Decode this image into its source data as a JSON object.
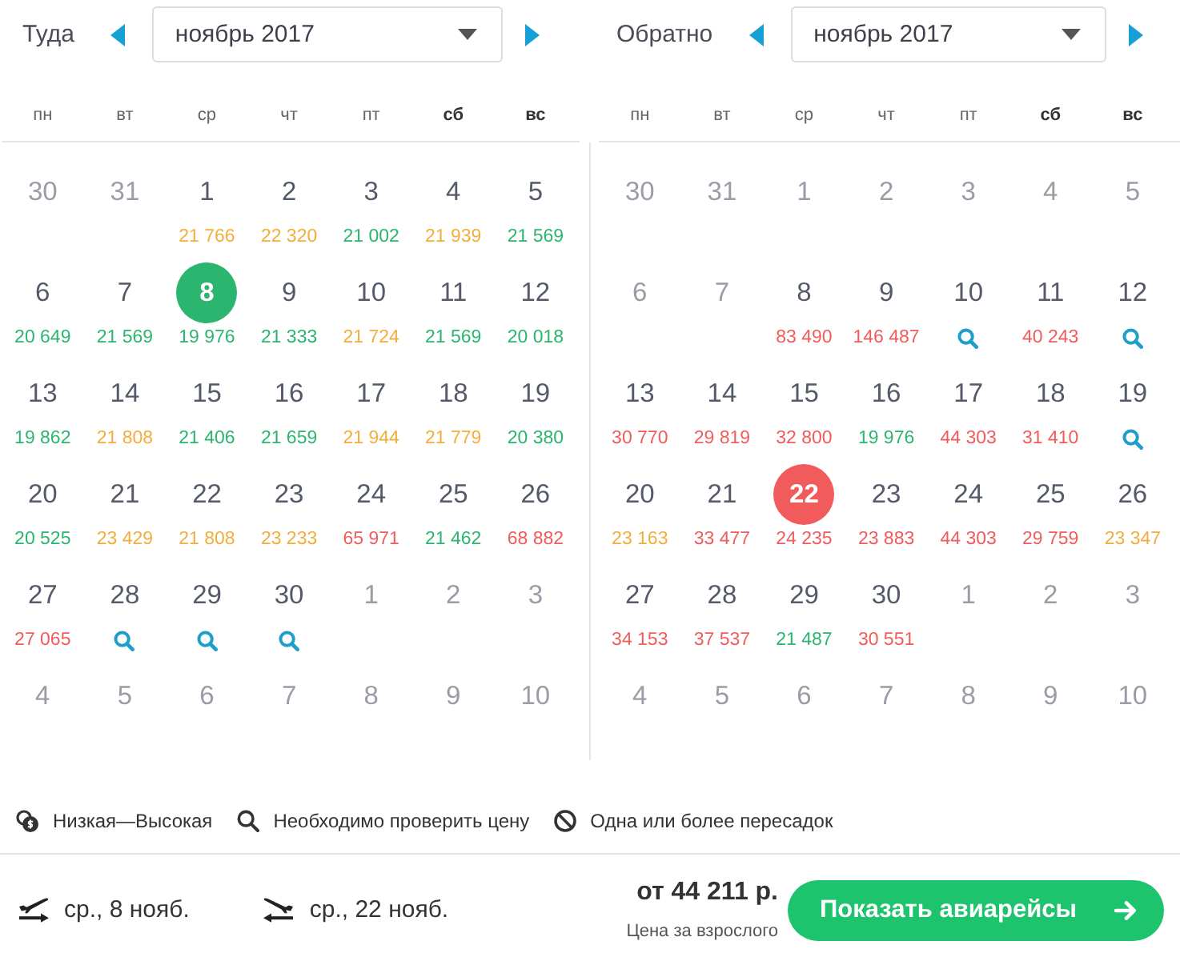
{
  "calendars": [
    {
      "label": "Туда",
      "month": "ноябрь 2017",
      "weekdays": [
        {
          "label": "пн",
          "weekend": false
        },
        {
          "label": "вт",
          "weekend": false
        },
        {
          "label": "ср",
          "weekend": false
        },
        {
          "label": "чт",
          "weekend": false
        },
        {
          "label": "пт",
          "weekend": false
        },
        {
          "label": "сб",
          "weekend": true
        },
        {
          "label": "вс",
          "weekend": true
        }
      ],
      "weeks": [
        [
          {
            "day": "30",
            "kind": "inactive",
            "selected": false
          },
          {
            "day": "31",
            "kind": "inactive",
            "selected": false
          },
          {
            "day": "1",
            "kind": "price",
            "price": "21 766",
            "color": "#f4ad3c",
            "selected": false
          },
          {
            "day": "2",
            "kind": "price",
            "price": "22 320",
            "color": "#f4ad3c",
            "selected": false
          },
          {
            "day": "3",
            "kind": "price",
            "price": "21 002",
            "color": "#2bb56f",
            "selected": false
          },
          {
            "day": "4",
            "kind": "price",
            "price": "21 939",
            "color": "#f4ad3c",
            "selected": false
          },
          {
            "day": "5",
            "kind": "price",
            "price": "21 569",
            "color": "#2bb56f",
            "selected": false
          }
        ],
        [
          {
            "day": "6",
            "kind": "price",
            "price": "20 649",
            "color": "#2bb56f",
            "selected": false
          },
          {
            "day": "7",
            "kind": "price",
            "price": "21 569",
            "color": "#2bb56f",
            "selected": false
          },
          {
            "day": "8",
            "kind": "price",
            "price": "19 976",
            "color": "#2bb56f",
            "selected": true
          },
          {
            "day": "9",
            "kind": "price",
            "price": "21 333",
            "color": "#2bb56f",
            "selected": false
          },
          {
            "day": "10",
            "kind": "price",
            "price": "21 724",
            "color": "#f4ad3c",
            "selected": false
          },
          {
            "day": "11",
            "kind": "price",
            "price": "21 569",
            "color": "#2bb56f",
            "selected": false
          },
          {
            "day": "12",
            "kind": "price",
            "price": "20 018",
            "color": "#2bb56f",
            "selected": false
          }
        ],
        [
          {
            "day": "13",
            "kind": "price",
            "price": "19 862",
            "color": "#2bb56f",
            "selected": false
          },
          {
            "day": "14",
            "kind": "price",
            "price": "21 808",
            "color": "#f4ad3c",
            "selected": false
          },
          {
            "day": "15",
            "kind": "price",
            "price": "21 406",
            "color": "#2bb56f",
            "selected": false
          },
          {
            "day": "16",
            "kind": "price",
            "price": "21 659",
            "color": "#2bb56f",
            "selected": false
          },
          {
            "day": "17",
            "kind": "price",
            "price": "21 944",
            "color": "#f4ad3c",
            "selected": false
          },
          {
            "day": "18",
            "kind": "price",
            "price": "21 779",
            "color": "#f4ad3c",
            "selected": false
          },
          {
            "day": "19",
            "kind": "price",
            "price": "20 380",
            "color": "#2bb56f",
            "selected": false
          }
        ],
        [
          {
            "day": "20",
            "kind": "price",
            "price": "20 525",
            "color": "#2bb56f",
            "selected": false
          },
          {
            "day": "21",
            "kind": "price",
            "price": "23 429",
            "color": "#f4ad3c",
            "selected": false
          },
          {
            "day": "22",
            "kind": "price",
            "price": "21 808",
            "color": "#f4ad3c",
            "selected": false
          },
          {
            "day": "23",
            "kind": "price",
            "price": "23 233",
            "color": "#f4ad3c",
            "selected": false
          },
          {
            "day": "24",
            "kind": "price",
            "price": "65 971",
            "color": "#f25b5b",
            "selected": false
          },
          {
            "day": "25",
            "kind": "price",
            "price": "21 462",
            "color": "#2bb56f",
            "selected": false
          },
          {
            "day": "26",
            "kind": "price",
            "price": "68 882",
            "color": "#f25b5b",
            "selected": false
          }
        ],
        [
          {
            "day": "27",
            "kind": "price",
            "price": "27 065",
            "color": "#f25b5b",
            "selected": false
          },
          {
            "day": "28",
            "kind": "search",
            "selected": false
          },
          {
            "day": "29",
            "kind": "search",
            "selected": false
          },
          {
            "day": "30",
            "kind": "search",
            "selected": false
          },
          {
            "day": "1",
            "kind": "inactive",
            "selected": false
          },
          {
            "day": "2",
            "kind": "inactive",
            "selected": false
          },
          {
            "day": "3",
            "kind": "inactive",
            "selected": false
          }
        ],
        [
          {
            "day": "4",
            "kind": "inactive",
            "selected": false
          },
          {
            "day": "5",
            "kind": "inactive",
            "selected": false
          },
          {
            "day": "6",
            "kind": "inactive",
            "selected": false
          },
          {
            "day": "7",
            "kind": "inactive",
            "selected": false
          },
          {
            "day": "8",
            "kind": "inactive",
            "selected": false
          },
          {
            "day": "9",
            "kind": "inactive",
            "selected": false
          },
          {
            "day": "10",
            "kind": "inactive",
            "selected": false
          }
        ]
      ]
    },
    {
      "label": "Обратно",
      "month": "ноябрь 2017",
      "weekdays": [
        {
          "label": "пн",
          "weekend": false
        },
        {
          "label": "вт",
          "weekend": false
        },
        {
          "label": "ср",
          "weekend": false
        },
        {
          "label": "чт",
          "weekend": false
        },
        {
          "label": "пт",
          "weekend": false
        },
        {
          "label": "сб",
          "weekend": true
        },
        {
          "label": "вс",
          "weekend": true
        }
      ],
      "weeks": [
        [
          {
            "day": "30",
            "kind": "inactive",
            "selected": false
          },
          {
            "day": "31",
            "kind": "inactive",
            "selected": false
          },
          {
            "day": "1",
            "kind": "inactive",
            "selected": false
          },
          {
            "day": "2",
            "kind": "inactive",
            "selected": false
          },
          {
            "day": "3",
            "kind": "inactive",
            "selected": false
          },
          {
            "day": "4",
            "kind": "inactive",
            "selected": false
          },
          {
            "day": "5",
            "kind": "inactive",
            "selected": false
          }
        ],
        [
          {
            "day": "6",
            "kind": "inactive",
            "selected": false
          },
          {
            "day": "7",
            "kind": "inactive",
            "selected": false
          },
          {
            "day": "8",
            "kind": "price",
            "price": "83 490",
            "color": "#f25b5b",
            "selected": false
          },
          {
            "day": "9",
            "kind": "price",
            "price": "146 487",
            "color": "#f25b5b",
            "selected": false
          },
          {
            "day": "10",
            "kind": "search",
            "selected": false
          },
          {
            "day": "11",
            "kind": "price",
            "price": "40 243",
            "color": "#f25b5b",
            "selected": false
          },
          {
            "day": "12",
            "kind": "search",
            "selected": false
          }
        ],
        [
          {
            "day": "13",
            "kind": "price",
            "price": "30 770",
            "color": "#f25b5b",
            "selected": false
          },
          {
            "day": "14",
            "kind": "price",
            "price": "29 819",
            "color": "#f25b5b",
            "selected": false
          },
          {
            "day": "15",
            "kind": "price",
            "price": "32 800",
            "color": "#f25b5b",
            "selected": false
          },
          {
            "day": "16",
            "kind": "price",
            "price": "19 976",
            "color": "#2bb56f",
            "selected": false
          },
          {
            "day": "17",
            "kind": "price",
            "price": "44 303",
            "color": "#f25b5b",
            "selected": false
          },
          {
            "day": "18",
            "kind": "price",
            "price": "31 410",
            "color": "#f25b5b",
            "selected": false
          },
          {
            "day": "19",
            "kind": "search",
            "selected": false
          }
        ],
        [
          {
            "day": "20",
            "kind": "price",
            "price": "23 163",
            "color": "#f4ad3c",
            "selected": false
          },
          {
            "day": "21",
            "kind": "price",
            "price": "33 477",
            "color": "#f25b5b",
            "selected": false
          },
          {
            "day": "22",
            "kind": "price",
            "price": "24 235",
            "color": "#f25b5b",
            "selected": true
          },
          {
            "day": "23",
            "kind": "price",
            "price": "23 883",
            "color": "#f25b5b",
            "selected": false
          },
          {
            "day": "24",
            "kind": "price",
            "price": "44 303",
            "color": "#f25b5b",
            "selected": false
          },
          {
            "day": "25",
            "kind": "price",
            "price": "29 759",
            "color": "#f25b5b",
            "selected": false
          },
          {
            "day": "26",
            "kind": "price",
            "price": "23 347",
            "color": "#f4ad3c",
            "selected": false
          }
        ],
        [
          {
            "day": "27",
            "kind": "price",
            "price": "34 153",
            "color": "#f25b5b",
            "selected": false
          },
          {
            "day": "28",
            "kind": "price",
            "price": "37 537",
            "color": "#f25b5b",
            "selected": false
          },
          {
            "day": "29",
            "kind": "price",
            "price": "21 487",
            "color": "#2bb56f",
            "selected": false
          },
          {
            "day": "30",
            "kind": "price",
            "price": "30 551",
            "color": "#f25b5b",
            "selected": false
          },
          {
            "day": "1",
            "kind": "inactive",
            "selected": false
          },
          {
            "day": "2",
            "kind": "inactive",
            "selected": false
          },
          {
            "day": "3",
            "kind": "inactive",
            "selected": false
          }
        ],
        [
          {
            "day": "4",
            "kind": "inactive",
            "selected": false
          },
          {
            "day": "5",
            "kind": "inactive",
            "selected": false
          },
          {
            "day": "6",
            "kind": "inactive",
            "selected": false
          },
          {
            "day": "7",
            "kind": "inactive",
            "selected": false
          },
          {
            "day": "8",
            "kind": "inactive",
            "selected": false
          },
          {
            "day": "9",
            "kind": "inactive",
            "selected": false
          },
          {
            "day": "10",
            "kind": "inactive",
            "selected": false
          }
        ]
      ]
    }
  ],
  "legend": [
    {
      "kind": "range",
      "text": "Низкая—Высокая"
    },
    {
      "kind": "search",
      "text": "Необходимо проверить цену"
    },
    {
      "kind": "stops",
      "text": "Одна или более пересадок"
    }
  ],
  "footer": {
    "legs": [
      {
        "kind": "depart",
        "date": "ср., 8 нояб."
      },
      {
        "kind": "return",
        "date": "ср., 22 нояб."
      }
    ],
    "price": "от 44 211 р.",
    "price_note": "Цена за взрослого",
    "button": "Показать авиарейсы"
  }
}
